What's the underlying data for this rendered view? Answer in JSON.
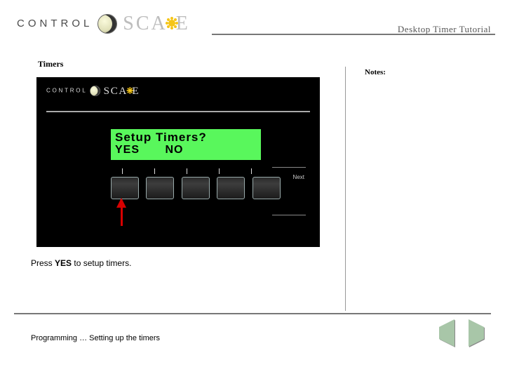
{
  "header": {
    "brand_control": "CONTROL",
    "brand_scape_before": "SCA",
    "brand_scape_after": "E",
    "title": "Desktop Timer Tutorial"
  },
  "section": {
    "heading": "Timers",
    "notes_label": "Notes:"
  },
  "device": {
    "brand_control": "CONTROL",
    "brand_scape_before": "SCA",
    "brand_scape_after": "E",
    "lcd_line1": "Setup Timers?",
    "lcd_yes": "YES",
    "lcd_no": "NO",
    "side_label_next": "Next"
  },
  "instruction": {
    "pre": "Press ",
    "yes": "YES",
    "post": " to setup timers."
  },
  "footer": {
    "text": "Programming … Setting up the timers"
  }
}
